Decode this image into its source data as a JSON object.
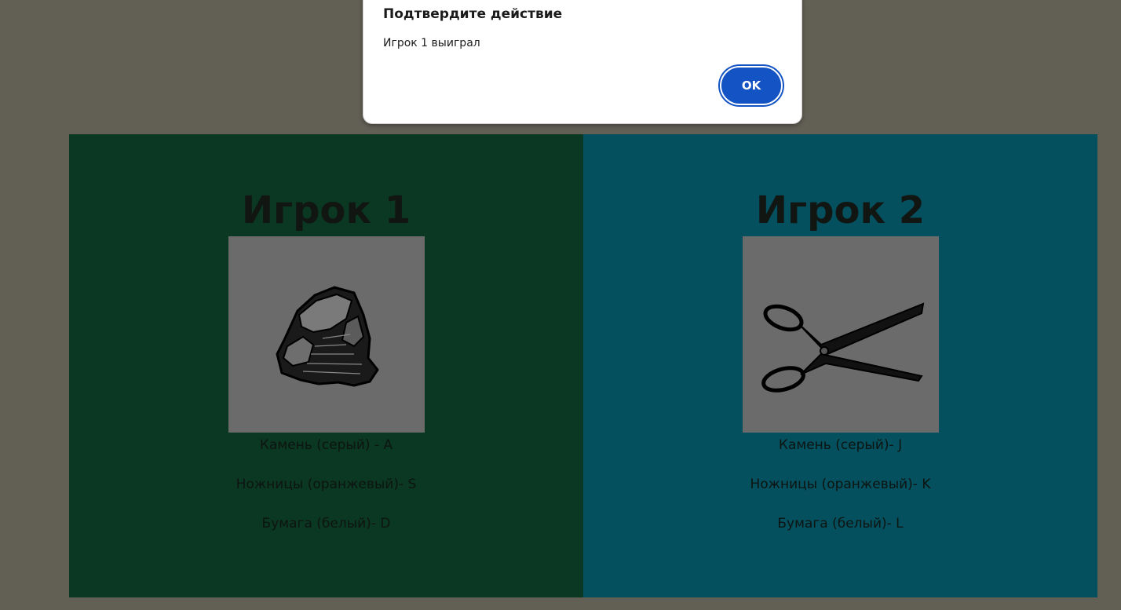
{
  "dialog": {
    "title": "Подтвердите действие",
    "message": "Игрок 1 выиграл",
    "ok_label": "OK"
  },
  "players": [
    {
      "title": "Игрок 1",
      "choice_icon": "rock-icon",
      "background": "#0b3822",
      "keys": [
        "Камень (серый) - A",
        "Ножницы (оранжевый)- S",
        "Бумага (белый)- D"
      ]
    },
    {
      "title": "Игрок 2",
      "choice_icon": "scissors-icon",
      "background": "#04505e",
      "keys": [
        "Камень (серый)- J",
        "Ножницы (оранжевый)- K",
        "Бумага (белый)- L"
      ]
    }
  ],
  "colors": {
    "page_background": "#625f55",
    "image_background": "#6b6b6b",
    "ok_button": "#1453c4"
  }
}
